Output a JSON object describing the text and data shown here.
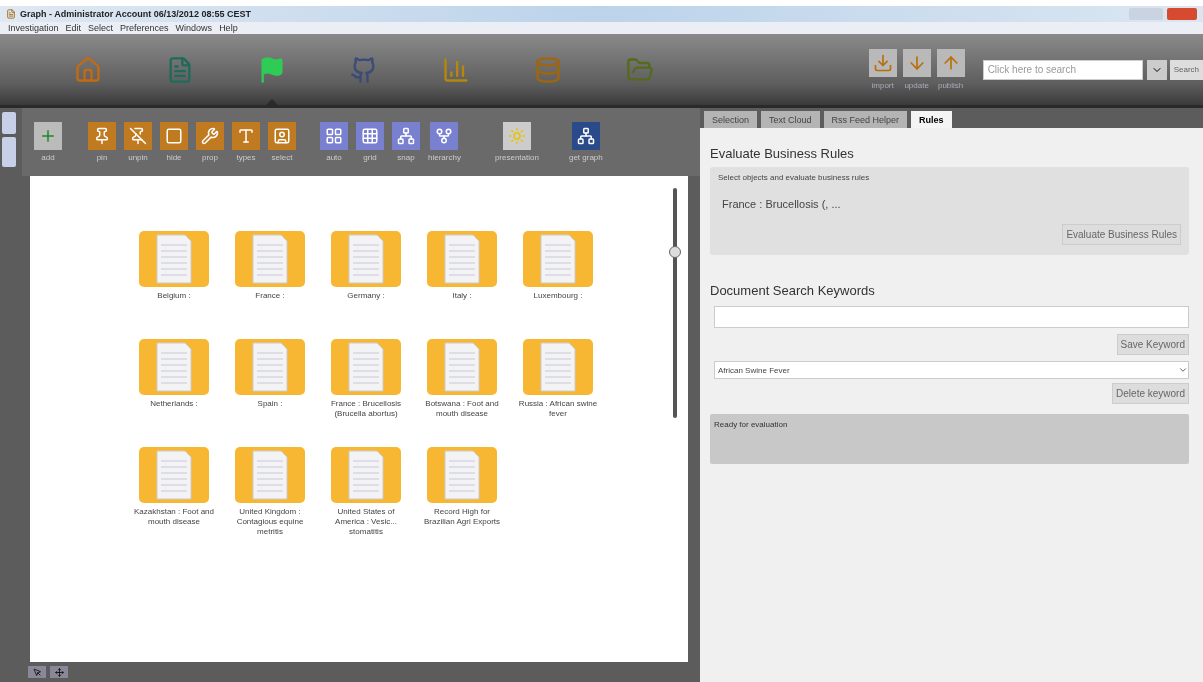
{
  "window": {
    "title": "Graph - Administrator Account 06/13/2012 08:55 CEST"
  },
  "menu": [
    "Investigation",
    "Edit",
    "Select",
    "Preferences",
    "Windows",
    "Help"
  ],
  "nav": [
    {
      "selected": false
    },
    {
      "selected": false
    },
    {
      "selected": true
    },
    {
      "selected": false
    },
    {
      "selected": false
    },
    {
      "selected": false
    },
    {
      "selected": false
    }
  ],
  "actions": [
    "import",
    "update",
    "publish"
  ],
  "search": {
    "placeholder": "Click here to search",
    "button": "Search"
  },
  "tools": [
    {
      "label": "add"
    },
    {
      "label": "pin"
    },
    {
      "label": "unpin"
    },
    {
      "label": "hide"
    },
    {
      "label": "prop"
    },
    {
      "label": "types"
    },
    {
      "label": "select"
    },
    {
      "label": "auto"
    },
    {
      "label": "grid"
    },
    {
      "label": "snap"
    },
    {
      "label": "hierarchy"
    },
    {
      "label": "presentation"
    },
    {
      "label": "get graph"
    }
  ],
  "documents": [
    {
      "label": "Belgium :"
    },
    {
      "label": "France :"
    },
    {
      "label": "Germany :"
    },
    {
      "label": "Italy :"
    },
    {
      "label": "Luxembourg :"
    },
    {
      "label": "Netherlands :"
    },
    {
      "label": "Spain :"
    },
    {
      "label": "France : Brucellosis (Brucella abortus)"
    },
    {
      "label": "Botswana : Foot and mouth disease"
    },
    {
      "label": "Russia : African swine fever"
    },
    {
      "label": "Kazakhstan : Foot and mouth disease"
    },
    {
      "label": "United Kingdom : Contagious equine metritis"
    },
    {
      "label": "United States of America : Vesic... stomatitis"
    },
    {
      "label": "Record High for Brazilian Agri Exports"
    }
  ],
  "zoom": {
    "level": 0.72
  },
  "tabs": [
    {
      "label": "Selection",
      "selected": false
    },
    {
      "label": "Text Cloud",
      "selected": false
    },
    {
      "label": "Rss Feed Helper",
      "selected": false
    },
    {
      "label": "Rules",
      "selected": true
    }
  ],
  "rules": {
    "heading": "Evaluate Business Rules",
    "legend": "Select objects and evaluate business rules",
    "selection": "France : Brucellosis (, ...",
    "button": "Evaluate Business Rules"
  },
  "keywords": {
    "heading": "Document Search Keywords",
    "save_button": "Save Keyword",
    "selected_keyword": "African Swine Fever",
    "delete_button": "Delete keyword"
  },
  "status": "Ready for evaluation"
}
